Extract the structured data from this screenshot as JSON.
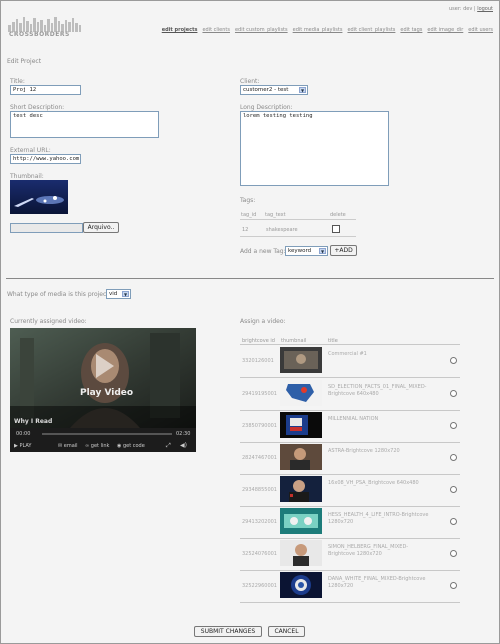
{
  "header": {
    "logo_text": "CROSSBORDERS",
    "user_label": "user:",
    "username": "dev",
    "separator": "|",
    "logout": "logout",
    "nav": [
      "edit projects",
      "edit clients",
      "edit custom_playlists",
      "edit media_playlists",
      "edit client_playlists",
      "edit tags",
      "edit image_dir",
      "edit users"
    ]
  },
  "page_title": "Edit Project",
  "form": {
    "title_label": "Title:",
    "title_value": "Proj 12",
    "client_label": "Client:",
    "client_value": "customer2 - test",
    "short_desc_label": "Short Description:",
    "short_desc_value": "test desc",
    "long_desc_label": "Long Description:",
    "long_desc_value": "lorem testing testing",
    "external_url_label": "External URL:",
    "external_url_value": "http://www.yahoo.com",
    "thumbnail_label": "Thumbnail:",
    "file_button": "Arquivo..",
    "tags_label": "Tags:",
    "tag_headers": [
      "tag_id",
      "tag_text",
      "delete"
    ],
    "tags": [
      {
        "id": "12",
        "text": "shakespeare"
      }
    ],
    "add_tag_label": "Add a new Tag:",
    "add_tag_select": "keyword",
    "add_button": "+ADD"
  },
  "media": {
    "question": "What type of media is this project?",
    "type_value": "vid",
    "assigned_label": "Currently assigned video:",
    "assign_label": "Assign a video:",
    "player": {
      "play_label": "Play Video",
      "video_title": "Why I Read",
      "time_start": "00:00",
      "time_end": "02:30",
      "controls": [
        "PLAY",
        "email",
        "get link",
        "get code"
      ]
    },
    "list_headers": [
      "brightcove id",
      "thumbnail",
      "title"
    ],
    "videos": [
      {
        "id": "3320126001",
        "title": "Commercial #1"
      },
      {
        "id": "29419195001",
        "title": "SD_ELECTION_FACTS_01_FINAL_MIXED-Brightcove 640x480"
      },
      {
        "id": "23850790001",
        "title": "MILLENNIAL NATION"
      },
      {
        "id": "28247467001",
        "title": "ASTRA-Brightcove 1280x720"
      },
      {
        "id": "29348855001",
        "title": "16x08_VH_PSA_Brightcove 640x480"
      },
      {
        "id": "29413202001",
        "title": "HESS_HEALTH_4_LIFE_INTRO-Brightcove 1280x720"
      },
      {
        "id": "32524076001",
        "title": "SIMON_HELBERG_FINAL_MIXED-Brightcove 1280x720"
      },
      {
        "id": "32522960001",
        "title": "DANA_WHITE_FINAL_MIXED-Brightcove 1280x720"
      }
    ]
  },
  "footer": {
    "submit": "SUBMIT CHANGES",
    "cancel": "CANCEL"
  }
}
